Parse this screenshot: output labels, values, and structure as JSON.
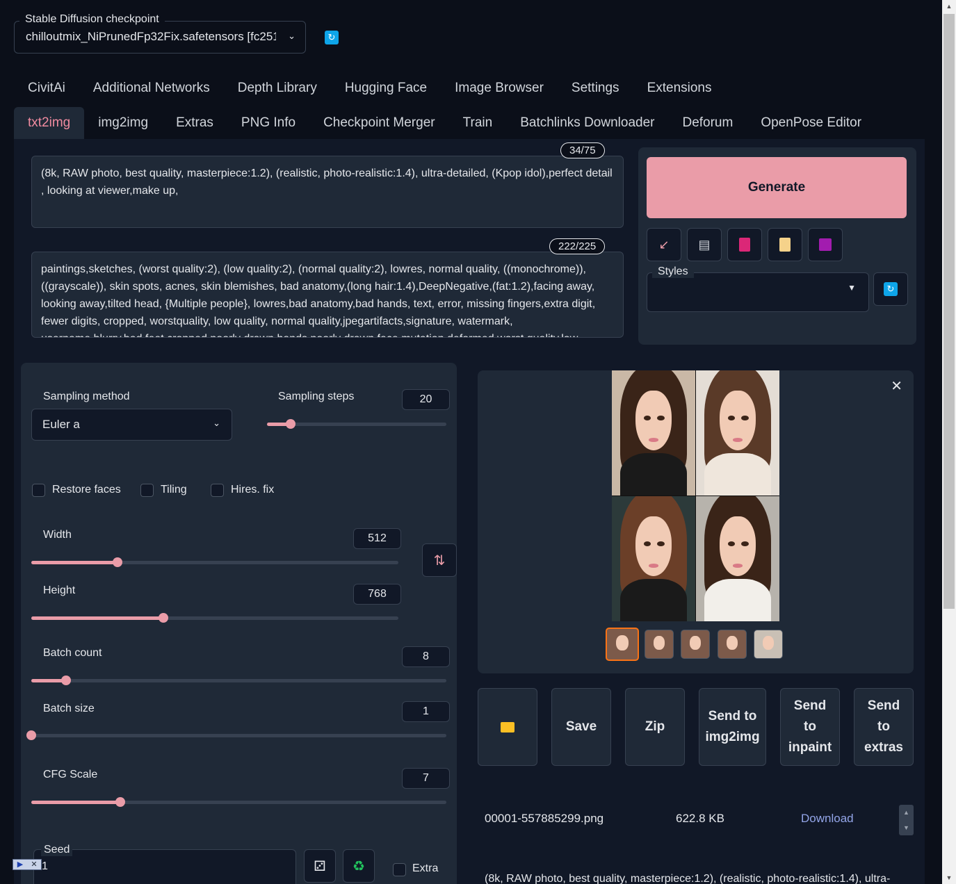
{
  "checkpoint": {
    "label": "Stable Diffusion checkpoint",
    "value": "chilloutmix_NiPrunedFp32Fix.safetensors [fc251"
  },
  "top_tabs": [
    "CivitAi",
    "Additional Networks",
    "Depth Library",
    "Hugging Face",
    "Image Browser",
    "Settings",
    "Extensions"
  ],
  "main_tabs": [
    "txt2img",
    "img2img",
    "Extras",
    "PNG Info",
    "Checkpoint Merger",
    "Train",
    "Batchlinks Downloader",
    "Deforum",
    "OpenPose Editor"
  ],
  "active_tab": "txt2img",
  "prompt": {
    "text": "(8k, RAW photo, best quality, masterpiece:1.2), (realistic, photo-realistic:1.4), ultra-detailed, (Kpop idol),perfect detail ,  looking at viewer,make up,",
    "token_count": "34/75"
  },
  "negative_prompt": {
    "text": "paintings,sketches, (worst quality:2), (low quality:2), (normal quality:2), lowres, normal quality, ((monochrome)), ((grayscale)), skin spots, acnes, skin blemishes, bad anatomy,(long hair:1.4),DeepNegative,(fat:1.2),facing away, looking away,tilted head, {Multiple people}, lowres,bad anatomy,bad hands, text, error, missing fingers,extra digit, fewer digits, cropped, worstquality, low quality, normal quality,jpegartifacts,signature, watermark, username,blurry,bad feet,cropped,poorly drawn hands,poorly drawn face,mutation,deformed,worst quality,low",
    "token_count": "222/225"
  },
  "generate_label": "Generate",
  "styles_label": "Styles",
  "sampling": {
    "method_label": "Sampling method",
    "method_value": "Euler a",
    "steps_label": "Sampling steps",
    "steps_value": "20",
    "steps_frac": 0.13
  },
  "checkboxes": {
    "restore_faces": "Restore faces",
    "tiling": "Tiling",
    "hires_fix": "Hires. fix"
  },
  "width": {
    "label": "Width",
    "value": "512",
    "frac": 0.235
  },
  "height": {
    "label": "Height",
    "value": "768",
    "frac": 0.36
  },
  "batch_count": {
    "label": "Batch count",
    "value": "8",
    "frac": 0.083
  },
  "batch_size": {
    "label": "Batch size",
    "value": "1",
    "frac": 0.0
  },
  "cfg_scale": {
    "label": "CFG Scale",
    "value": "7",
    "frac": 0.215
  },
  "seed": {
    "label": "Seed",
    "value": "1",
    "extra_label": "Extra"
  },
  "output_buttons": {
    "folder": "folder-icon",
    "save": "Save",
    "zip": "Zip",
    "send_img2img": "Send to img2img",
    "send_inpaint": "Send to inpaint",
    "send_extras": "Send to extras"
  },
  "file": {
    "name": "00001-557885299.png",
    "size": "622.8 KB",
    "download": "Download"
  },
  "info_text": "(8k, RAW photo, best quality, masterpiece:1.2), (realistic, photo-realistic:1.4), ultra-",
  "colors": {
    "accent": "#ea9ca8",
    "bg": "#0b0f19",
    "panel": "#1f2937",
    "active_tab": "#f08ba0"
  }
}
